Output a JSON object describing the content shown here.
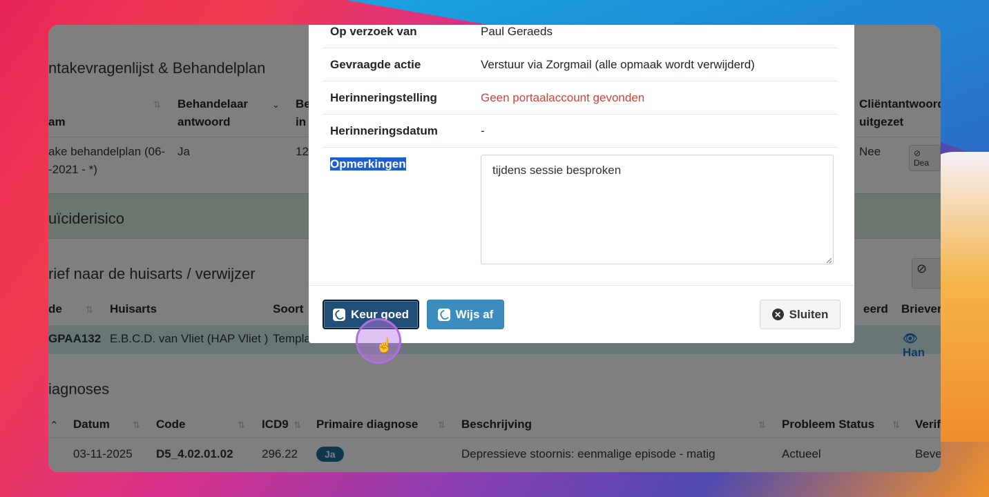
{
  "background": {
    "section1_title": "ntakevragenlijst & Behandelplan",
    "table1_headers": [
      "am",
      "Behandelaar\nantwoord",
      "Be\nin",
      "Cliëntantwoord\nuitgezet"
    ],
    "table1_cells": [
      "ake behandelplan (06-\n-2021 - *)",
      "Ja",
      "12",
      "Nee",
      "Dea"
    ],
    "section2_title": "uïciderisico",
    "section3_title": "rief naar de huisarts / verwijzer",
    "table3_headers": [
      "de",
      "Huisarts",
      "Soort",
      "eerd",
      "Briever"
    ],
    "table3_cells": [
      "GPAA132",
      "E.B.C.D. van Vliet (HAP Vliet )",
      "Templa",
      "Han"
    ],
    "section4_title": "iagnoses",
    "table4_headers": [
      "Datum",
      "Code",
      "ICD9",
      "Primaire diagnose",
      "Beschrijving",
      "Probleem Status",
      "Verif"
    ],
    "table4_cells": [
      "03-11-2025",
      "D5_4.02.01.02",
      "296.22",
      "Ja",
      "Depressieve stoornis: eenmalige episode - matig",
      "Actueel",
      "Beve"
    ]
  },
  "modal": {
    "rows": [
      {
        "label": "Op verzoek van",
        "value": "Paul Geraeds"
      },
      {
        "label": "Gevraagde actie",
        "value": "Verstuur via Zorgmail (alle opmaak wordt verwijderd)"
      },
      {
        "label": "Herinneringstelling",
        "value": "Geen portaalaccount gevonden"
      },
      {
        "label": "Herinneringsdatum",
        "value": "-"
      },
      {
        "label": "Opmerkingen",
        "value": "tijdens sessie besproken"
      }
    ],
    "buttons": {
      "approve": "Keur goed",
      "reject": "Wijs af",
      "close": "Sluiten"
    }
  },
  "colors": {
    "approve_button": "#214e77",
    "reject_button": "#3c8dbf",
    "error_text": "#c9463d",
    "selection_highlight": "#1d5fd1"
  }
}
